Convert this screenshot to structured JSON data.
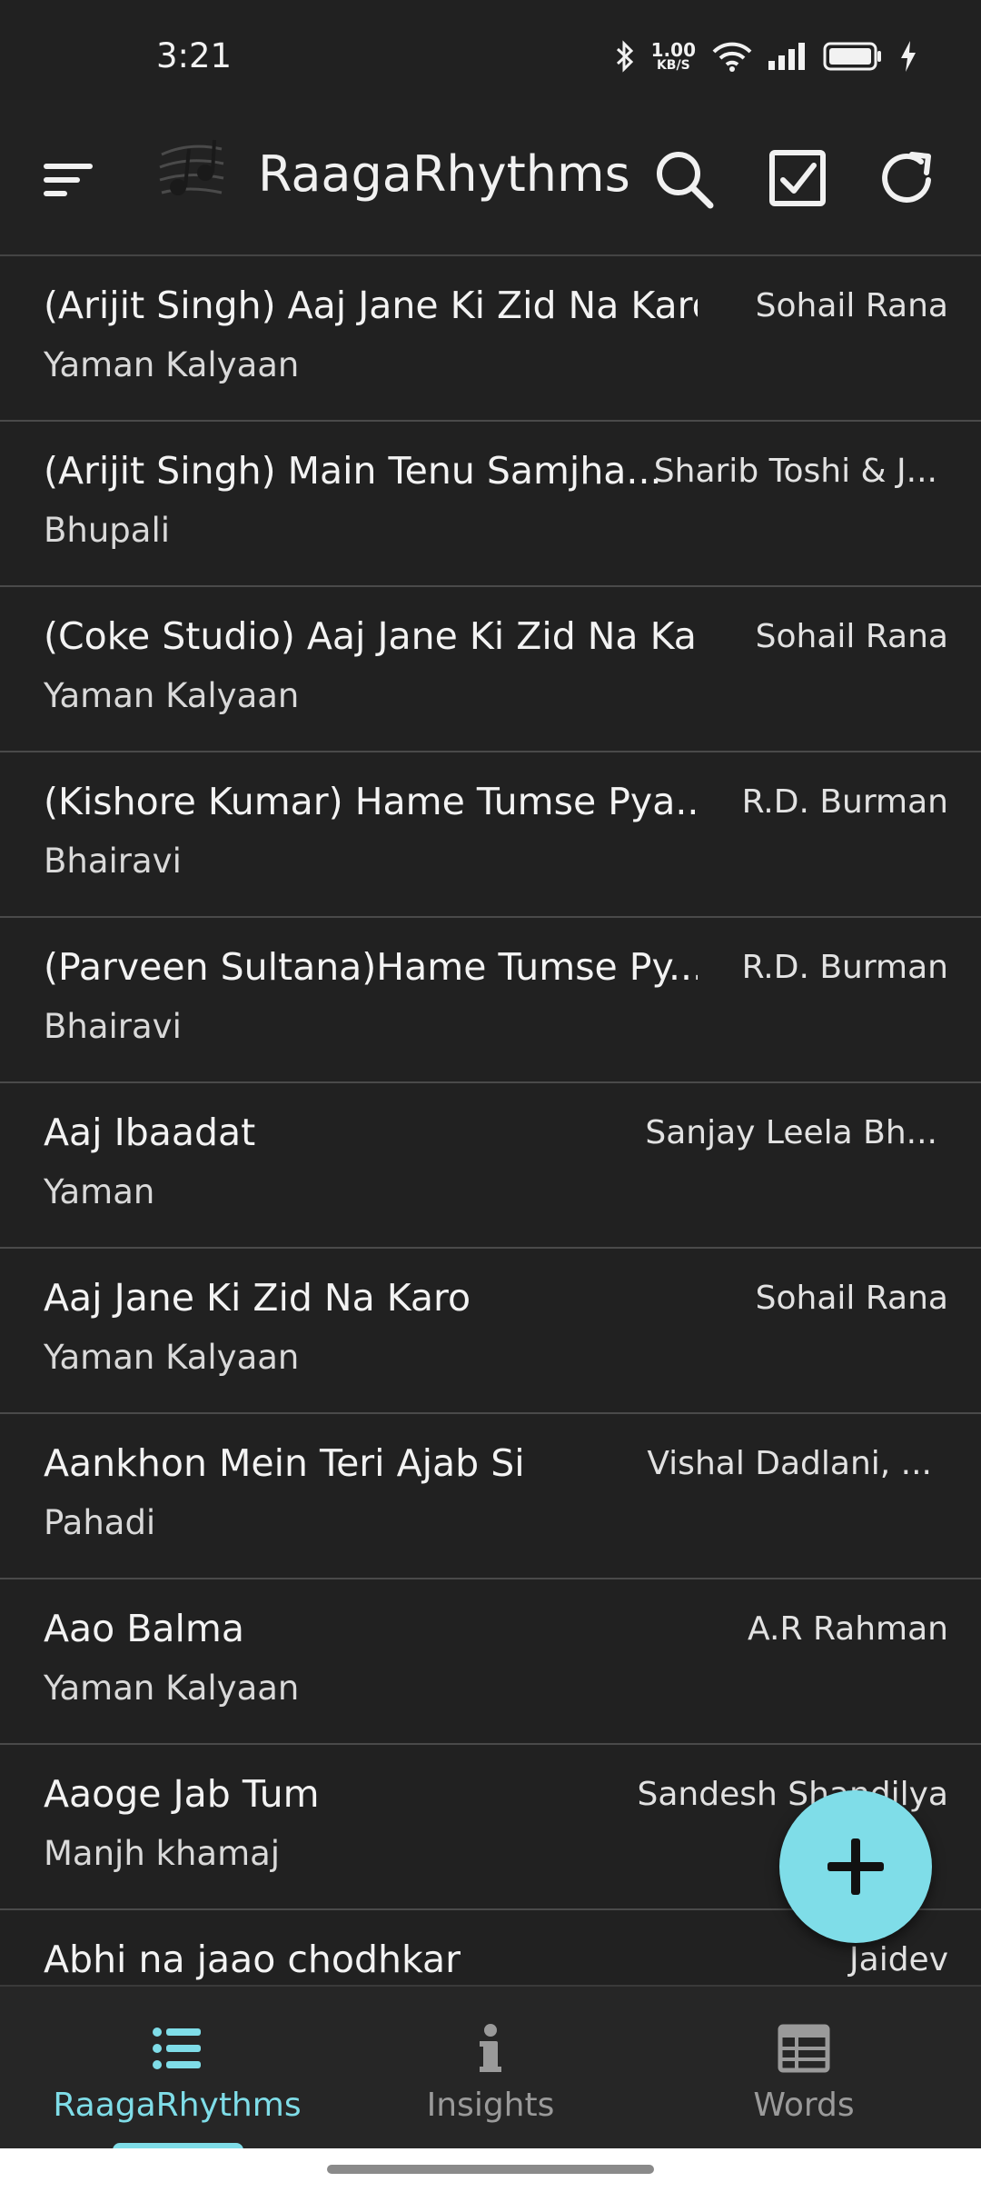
{
  "status_bar": {
    "time": "3:21",
    "net_speed_value": "1.00",
    "net_speed_unit": "KB/S",
    "icons": [
      "bluetooth-icon",
      "wifi-icon",
      "signal-icon",
      "battery-icon",
      "charging-icon"
    ]
  },
  "app_bar": {
    "title": "RaagaRhythms",
    "icons": [
      "menu-icon",
      "logo-icon",
      "search-icon",
      "checkbox-icon",
      "refresh-icon"
    ]
  },
  "songs": [
    {
      "title": "(Arijit Singh) Aaj Jane Ki Zid Na Karo",
      "artist": "Sohail Rana",
      "raga": "Yaman Kalyaan"
    },
    {
      "title": "(Arijit Singh) Main Tenu Samjha...",
      "artist": "Sharib Toshi & J...",
      "raga": "Bhupali"
    },
    {
      "title": "(Coke Studio) Aaj Jane Ki Zid Na Ka...",
      "artist": "Sohail Rana",
      "raga": "Yaman Kalyaan"
    },
    {
      "title": "(Kishore Kumar) Hame Tumse Pya...",
      "artist": "R.D. Burman",
      "raga": "Bhairavi"
    },
    {
      "title": "(Parveen Sultana)Hame Tumse Py...",
      "artist": "R.D. Burman",
      "raga": "Bhairavi"
    },
    {
      "title": "Aaj Ibaadat",
      "artist": "Sanjay Leela Bh...",
      "raga": "Yaman"
    },
    {
      "title": "Aaj Jane Ki Zid Na Karo",
      "artist": "Sohail Rana",
      "raga": "Yaman Kalyaan"
    },
    {
      "title": "Aankhon Mein Teri Ajab Si",
      "artist": "Vishal Dadlani, ...",
      "raga": "Pahadi"
    },
    {
      "title": "Aao Balma",
      "artist": "A.R Rahman",
      "raga": "Yaman Kalyaan"
    },
    {
      "title": "Aaoge Jab Tum",
      "artist": "Sandesh Shandilya",
      "raga": "Manjh khamaj"
    },
    {
      "title": "Abhi na jaao chodhkar",
      "artist": "Jaidev",
      "raga": ""
    }
  ],
  "fab": {
    "icon": "plus-icon"
  },
  "bottom_nav": {
    "items": [
      {
        "label": "RaagaRhythms",
        "icon": "list-icon",
        "active": true
      },
      {
        "label": "Insights",
        "icon": "info-icon",
        "active": false
      },
      {
        "label": "Words",
        "icon": "table-icon",
        "active": false
      }
    ]
  },
  "colors": {
    "background": "#212121",
    "accent": "#7fdde8",
    "inactive_nav": "#9a9a9a",
    "divider": "#4a4a4a"
  }
}
